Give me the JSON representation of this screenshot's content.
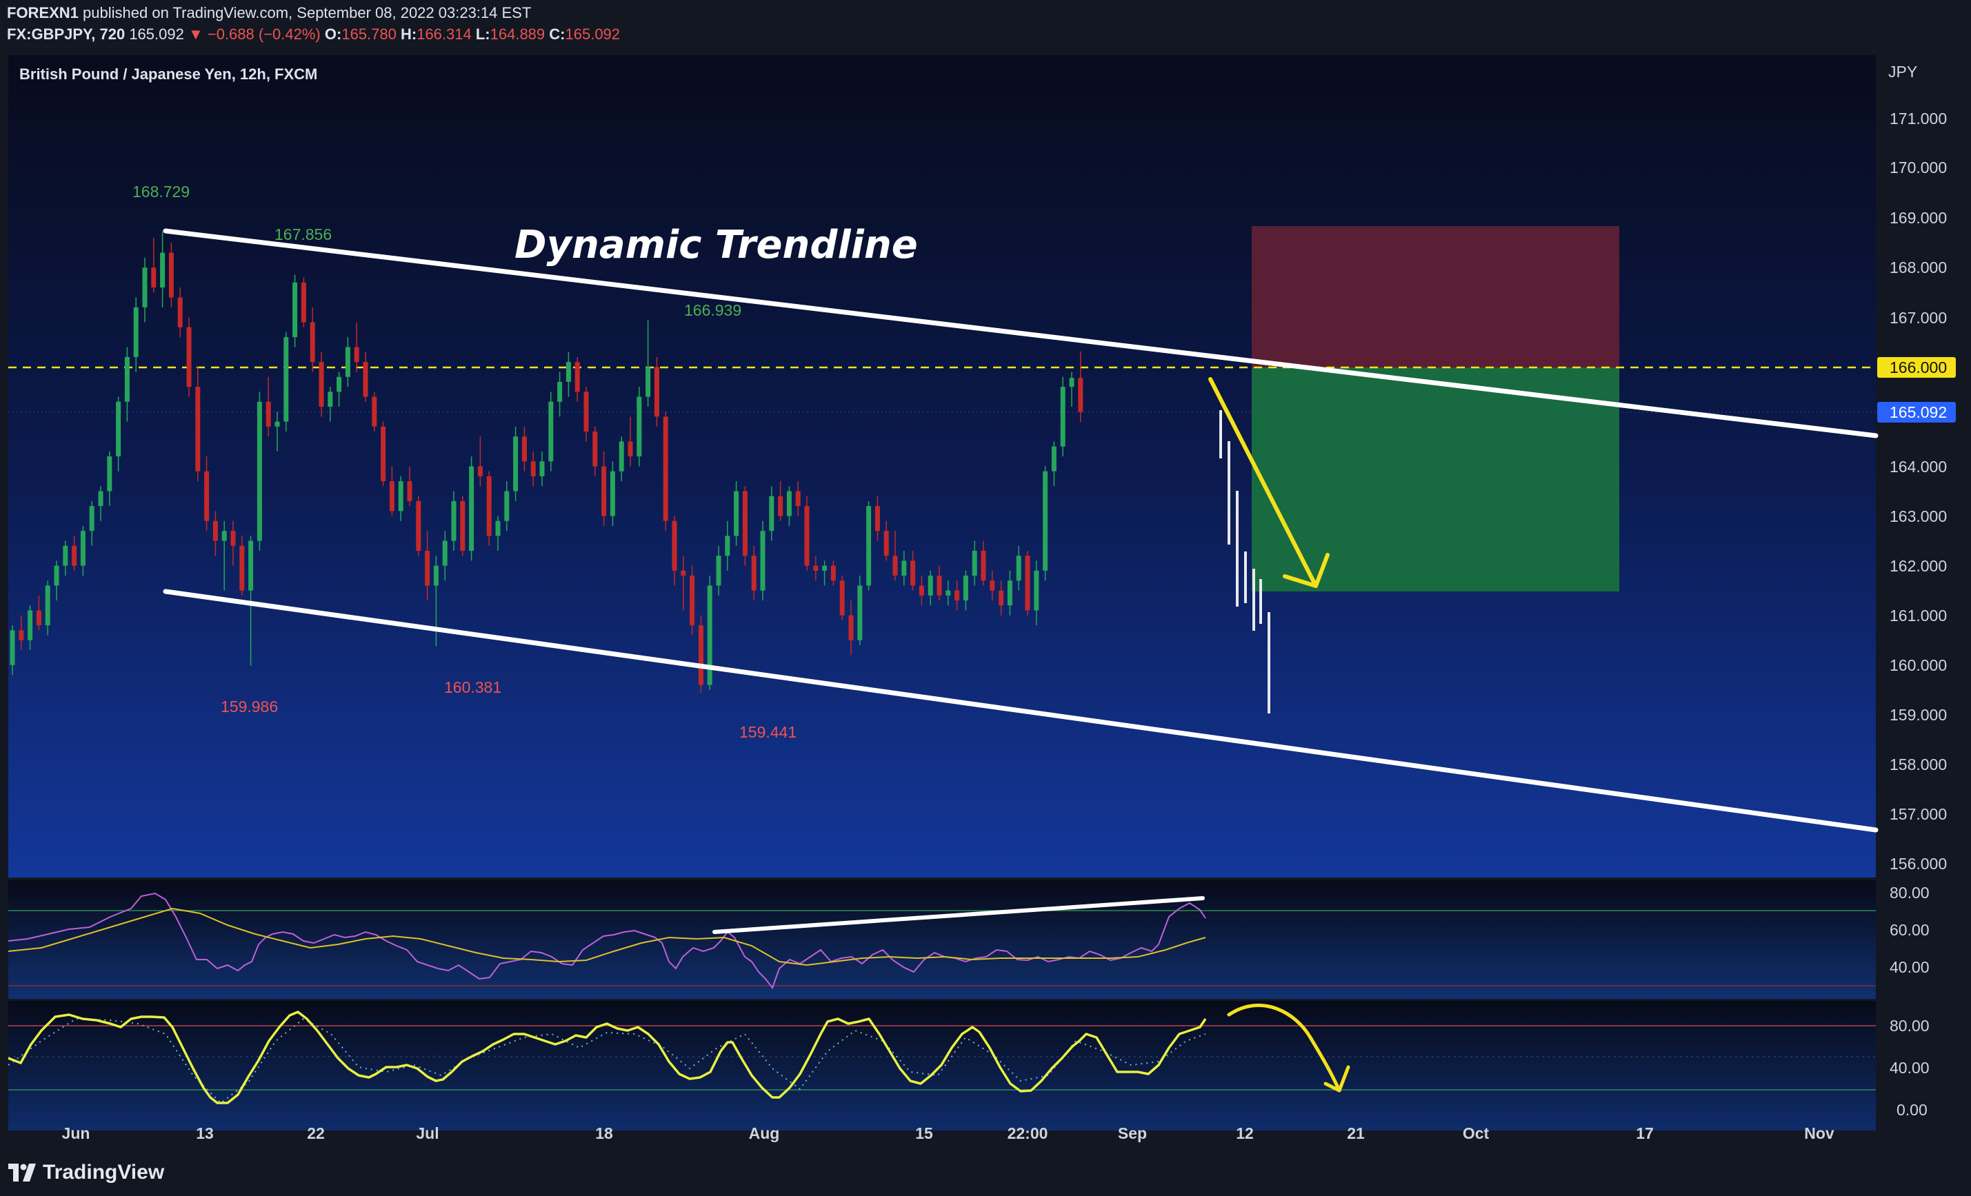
{
  "header": {
    "publisher": "FOREXN1",
    "publish_text": "published on TradingView.com, September 08, 2022 03:23:14 EST",
    "symbol": "FX:GBPJPY, 720",
    "last_price": "165.092",
    "change": "▼ −0.688 (−0.42%)",
    "o_label": "O:",
    "o_value": "165.780",
    "h_label": "H:",
    "h_value": "166.314",
    "l_label": "L:",
    "l_value": "164.889",
    "c_label": "C:",
    "c_value": "165.092"
  },
  "chart": {
    "legend_title": "British Pound / Japanese Yen, 12h, FXCM",
    "currency_label": "JPY",
    "price_ticks": [
      "171.000",
      "170.000",
      "169.000",
      "168.000",
      "167.000",
      "164.000",
      "163.000",
      "162.000",
      "161.000",
      "160.000",
      "159.000",
      "158.000",
      "157.000",
      "156.000"
    ],
    "level_badge": "166.000",
    "last_price_badge": "165.092",
    "annotation_title": "Dynamic Trendline",
    "peak_labels": [
      "168.729",
      "167.856",
      "166.939"
    ],
    "trough_labels": [
      "159.986",
      "160.381",
      "159.441"
    ]
  },
  "rsi": {
    "ticks": [
      "80.00",
      "60.00",
      "40.00"
    ]
  },
  "stoch": {
    "ticks": [
      "80.00",
      "40.00",
      "0.00"
    ]
  },
  "time_axis": [
    "Jun",
    "13",
    "22",
    "Jul",
    "18",
    "Aug",
    "15",
    "22:00",
    "Sep",
    "12",
    "21",
    "Oct",
    "17",
    "Nov"
  ],
  "branding": {
    "logo_text": "TradingView"
  },
  "colors": {
    "bull": "#26a65b",
    "bear": "#c62828",
    "level": "#f5e11a",
    "rsi_line": "#c060d8",
    "rsi_ma": "#e0c028",
    "stoch_line": "#e8f040",
    "stoch_signal": "#7fb0d8",
    "stop_zone": "#5a1f35",
    "target_zone": "#186b40",
    "peak_label": "#4caf50",
    "trough_label": "#ef5350"
  },
  "chart_data": {
    "type": "candlestick",
    "symbol": "GBPJPY",
    "interval": "12h",
    "currency": "JPY",
    "price_range": [
      155.7,
      171.7
    ],
    "annotations": {
      "horizontal_level": 166.0,
      "last_price": 165.092,
      "peaks": [
        168.729,
        167.856,
        166.939
      ],
      "troughs": [
        159.986,
        160.381,
        159.441
      ],
      "trade_box": {
        "stop_top": 168.85,
        "entry": 166.0,
        "target": 161.5
      }
    },
    "candles": [
      [
        160.0,
        160.8,
        159.8,
        160.7
      ],
      [
        160.7,
        161.0,
        160.3,
        160.5
      ],
      [
        160.5,
        161.2,
        160.3,
        161.1
      ],
      [
        161.1,
        161.4,
        160.7,
        160.8
      ],
      [
        160.8,
        161.7,
        160.6,
        161.6
      ],
      [
        161.6,
        162.1,
        161.3,
        162.0
      ],
      [
        162.0,
        162.5,
        161.8,
        162.4
      ],
      [
        162.4,
        162.6,
        161.9,
        162.0
      ],
      [
        162.0,
        162.8,
        161.8,
        162.7
      ],
      [
        162.7,
        163.3,
        162.4,
        163.2
      ],
      [
        163.2,
        163.6,
        162.9,
        163.5
      ],
      [
        163.5,
        164.3,
        163.2,
        164.2
      ],
      [
        164.2,
        165.4,
        163.9,
        165.3
      ],
      [
        165.3,
        166.4,
        164.9,
        166.2
      ],
      [
        166.2,
        167.4,
        165.9,
        167.2
      ],
      [
        167.2,
        168.2,
        166.9,
        168.0
      ],
      [
        168.0,
        168.6,
        167.5,
        167.6
      ],
      [
        167.6,
        168.729,
        167.2,
        168.3
      ],
      [
        168.3,
        168.5,
        167.2,
        167.4
      ],
      [
        167.4,
        167.6,
        166.6,
        166.8
      ],
      [
        166.8,
        167.0,
        165.4,
        165.6
      ],
      [
        165.6,
        166.0,
        163.7,
        163.9
      ],
      [
        163.9,
        164.2,
        162.7,
        162.9
      ],
      [
        162.9,
        163.1,
        162.2,
        162.5
      ],
      [
        162.5,
        162.9,
        161.5,
        162.7
      ],
      [
        162.7,
        162.9,
        162.0,
        162.4
      ],
      [
        162.4,
        162.6,
        161.4,
        161.5
      ],
      [
        161.5,
        162.6,
        159.986,
        162.5
      ],
      [
        162.5,
        165.5,
        162.3,
        165.3
      ],
      [
        165.3,
        165.8,
        164.6,
        164.8
      ],
      [
        164.8,
        165.1,
        164.3,
        164.9
      ],
      [
        164.9,
        166.7,
        164.7,
        166.6
      ],
      [
        166.6,
        167.856,
        166.4,
        167.7
      ],
      [
        167.7,
        167.8,
        166.8,
        166.9
      ],
      [
        166.9,
        167.2,
        165.9,
        166.1
      ],
      [
        166.1,
        166.3,
        165.0,
        165.2
      ],
      [
        165.2,
        165.6,
        164.9,
        165.5
      ],
      [
        165.5,
        165.9,
        165.2,
        165.8
      ],
      [
        165.8,
        166.6,
        165.6,
        166.4
      ],
      [
        166.4,
        166.9,
        165.9,
        166.1
      ],
      [
        166.1,
        166.3,
        165.3,
        165.4
      ],
      [
        165.4,
        165.5,
        164.7,
        164.8
      ],
      [
        164.8,
        164.9,
        163.6,
        163.7
      ],
      [
        163.7,
        164.0,
        163.0,
        163.1
      ],
      [
        163.1,
        163.8,
        162.9,
        163.7
      ],
      [
        163.7,
        164.0,
        163.2,
        163.3
      ],
      [
        163.3,
        163.4,
        162.2,
        162.3
      ],
      [
        162.3,
        162.7,
        161.3,
        161.6
      ],
      [
        161.6,
        162.2,
        160.381,
        162.0
      ],
      [
        162.0,
        162.7,
        161.7,
        162.5
      ],
      [
        162.5,
        163.5,
        162.3,
        163.3
      ],
      [
        163.3,
        163.4,
        162.2,
        162.3
      ],
      [
        162.3,
        164.2,
        162.1,
        164.0
      ],
      [
        164.0,
        164.6,
        163.6,
        163.8
      ],
      [
        163.8,
        163.9,
        162.4,
        162.6
      ],
      [
        162.6,
        163.0,
        162.3,
        162.9
      ],
      [
        162.9,
        163.7,
        162.7,
        163.5
      ],
      [
        163.5,
        164.8,
        163.3,
        164.6
      ],
      [
        164.6,
        164.8,
        163.9,
        164.1
      ],
      [
        164.1,
        164.3,
        163.6,
        163.8
      ],
      [
        163.8,
        164.3,
        163.6,
        164.1
      ],
      [
        164.1,
        165.5,
        163.9,
        165.3
      ],
      [
        165.3,
        165.9,
        165.0,
        165.7
      ],
      [
        165.7,
        166.3,
        165.4,
        166.1
      ],
      [
        166.1,
        166.2,
        165.3,
        165.5
      ],
      [
        165.5,
        165.6,
        164.5,
        164.7
      ],
      [
        164.7,
        164.8,
        163.8,
        164.0
      ],
      [
        164.0,
        164.3,
        162.8,
        163.0
      ],
      [
        163.0,
        164.1,
        162.8,
        163.9
      ],
      [
        163.9,
        164.6,
        163.7,
        164.5
      ],
      [
        164.5,
        165.0,
        164.0,
        164.2
      ],
      [
        164.2,
        165.6,
        164.0,
        165.4
      ],
      [
        165.4,
        166.939,
        165.2,
        166.0
      ],
      [
        166.0,
        166.2,
        164.8,
        165.0
      ],
      [
        165.0,
        165.1,
        162.7,
        162.9
      ],
      [
        162.9,
        163.0,
        161.6,
        161.9
      ],
      [
        161.9,
        162.2,
        161.1,
        161.8
      ],
      [
        161.8,
        162.0,
        160.6,
        160.8
      ],
      [
        160.8,
        161.0,
        159.441,
        159.6
      ],
      [
        159.6,
        161.8,
        159.5,
        161.6
      ],
      [
        161.6,
        162.4,
        161.4,
        162.2
      ],
      [
        162.2,
        162.9,
        161.9,
        162.6
      ],
      [
        162.6,
        163.7,
        162.4,
        163.5
      ],
      [
        163.5,
        163.6,
        162.0,
        162.2
      ],
      [
        162.2,
        162.4,
        161.3,
        161.5
      ],
      [
        161.5,
        162.9,
        161.3,
        162.7
      ],
      [
        162.7,
        163.6,
        162.5,
        163.4
      ],
      [
        163.4,
        163.7,
        162.9,
        163.0
      ],
      [
        163.0,
        163.6,
        162.8,
        163.5
      ],
      [
        163.5,
        163.7,
        163.0,
        163.2
      ],
      [
        163.2,
        163.4,
        161.9,
        162.0
      ],
      [
        162.0,
        162.2,
        161.7,
        161.9
      ],
      [
        161.9,
        162.1,
        161.6,
        162.0
      ],
      [
        162.0,
        162.1,
        161.6,
        161.7
      ],
      [
        161.7,
        161.8,
        160.9,
        161.0
      ],
      [
        161.0,
        161.3,
        160.2,
        160.5
      ],
      [
        160.5,
        161.8,
        160.4,
        161.6
      ],
      [
        161.6,
        163.3,
        161.5,
        163.2
      ],
      [
        163.2,
        163.4,
        162.5,
        162.7
      ],
      [
        162.7,
        162.9,
        162.1,
        162.2
      ],
      [
        162.2,
        162.7,
        161.7,
        161.8
      ],
      [
        161.8,
        162.3,
        161.6,
        162.1
      ],
      [
        162.1,
        162.3,
        161.5,
        161.6
      ],
      [
        161.6,
        161.8,
        161.2,
        161.4
      ],
      [
        161.4,
        161.9,
        161.2,
        161.8
      ],
      [
        161.8,
        162.0,
        161.3,
        161.4
      ],
      [
        161.4,
        161.7,
        161.2,
        161.5
      ],
      [
        161.5,
        161.7,
        161.1,
        161.3
      ],
      [
        161.3,
        161.9,
        161.1,
        161.8
      ],
      [
        161.8,
        162.5,
        161.6,
        162.3
      ],
      [
        162.3,
        162.5,
        161.6,
        161.7
      ],
      [
        161.7,
        161.9,
        161.3,
        161.5
      ],
      [
        161.5,
        161.7,
        161.0,
        161.2
      ],
      [
        161.2,
        161.9,
        161.0,
        161.7
      ],
      [
        161.7,
        162.4,
        161.5,
        162.2
      ],
      [
        162.2,
        162.3,
        161.0,
        161.1
      ],
      [
        161.1,
        162.1,
        160.8,
        161.9
      ],
      [
        161.9,
        164.0,
        161.7,
        163.9
      ],
      [
        163.9,
        164.5,
        163.6,
        164.4
      ],
      [
        164.4,
        165.8,
        164.2,
        165.6
      ],
      [
        165.6,
        165.9,
        165.2,
        165.78
      ],
      [
        165.78,
        166.314,
        164.889,
        165.092
      ]
    ]
  }
}
